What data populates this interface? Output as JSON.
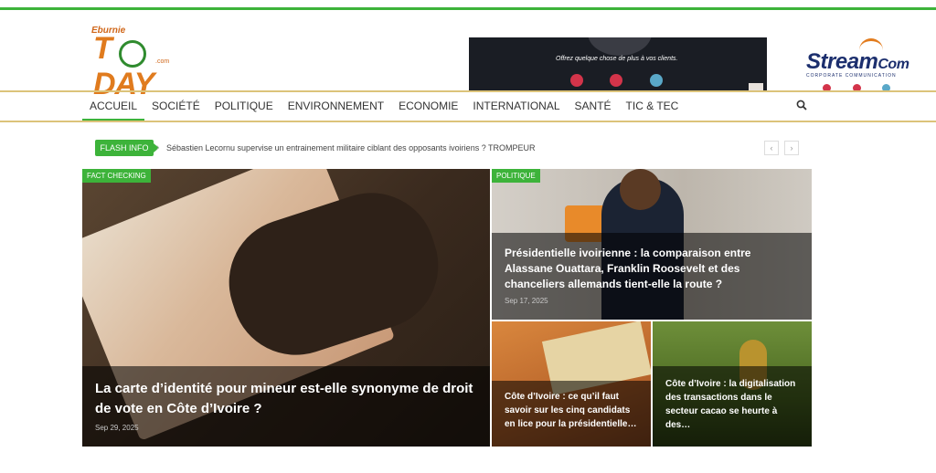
{
  "header": {
    "logo": {
      "small": "Eburnie",
      "big": "T  DAY",
      "com": ".com"
    },
    "banner": {
      "text": "Offrez quelque chose de plus à vos clients."
    },
    "stream_logo": {
      "word": "Stream",
      "com": "Com",
      "sub": "CORPORATE COMMUNICATION"
    }
  },
  "nav": {
    "items": [
      "ACCUEIL",
      "SOCIÉTÉ",
      "POLITIQUE",
      "ENVIRONNEMENT",
      "ECONOMIE",
      "INTERNATIONAL",
      "SANTÉ",
      "TIC & TEC"
    ],
    "active_index": 0
  },
  "flash": {
    "label": "FLASH INFO",
    "separator": "›",
    "text": "Sébastien Lecornu supervise un entrainement militaire ciblant des opposants ivoiriens ? TROMPEUR",
    "prev": "‹",
    "next": "›"
  },
  "cards": [
    {
      "category": "FACT CHECKING",
      "title": "La carte d’identité pour mineur est-elle synonyme de droit de vote en Côte d’Ivoire ?",
      "date": "Sep 29, 2025"
    },
    {
      "category": "POLITIQUE",
      "title": "Présidentielle ivoirienne : la comparaison entre Alassane Ouattara, Franklin Roosevelt et des chanceliers allemands tient-elle la route ?",
      "date": "Sep 17, 2025"
    },
    {
      "category": "",
      "title": "Côte d’Ivoire : ce qu’il faut savoir sur les cinq candidats en lice pour la présidentielle…",
      "date": ""
    },
    {
      "category": "",
      "title": "Côte d’Ivoire : la digitalisation des transactions dans le secteur cacao se heurte à des…",
      "date": ""
    }
  ],
  "colors": {
    "accent": "#3db33a",
    "nav_border": "#dcc37a",
    "brand_orange": "#e07b1e",
    "brand_navy": "#1c2f6e"
  },
  "icons": [
    "search-icon",
    "chevron-left-icon",
    "chevron-right-icon",
    "instagram-icon",
    "youtube-icon",
    "web-icon"
  ]
}
